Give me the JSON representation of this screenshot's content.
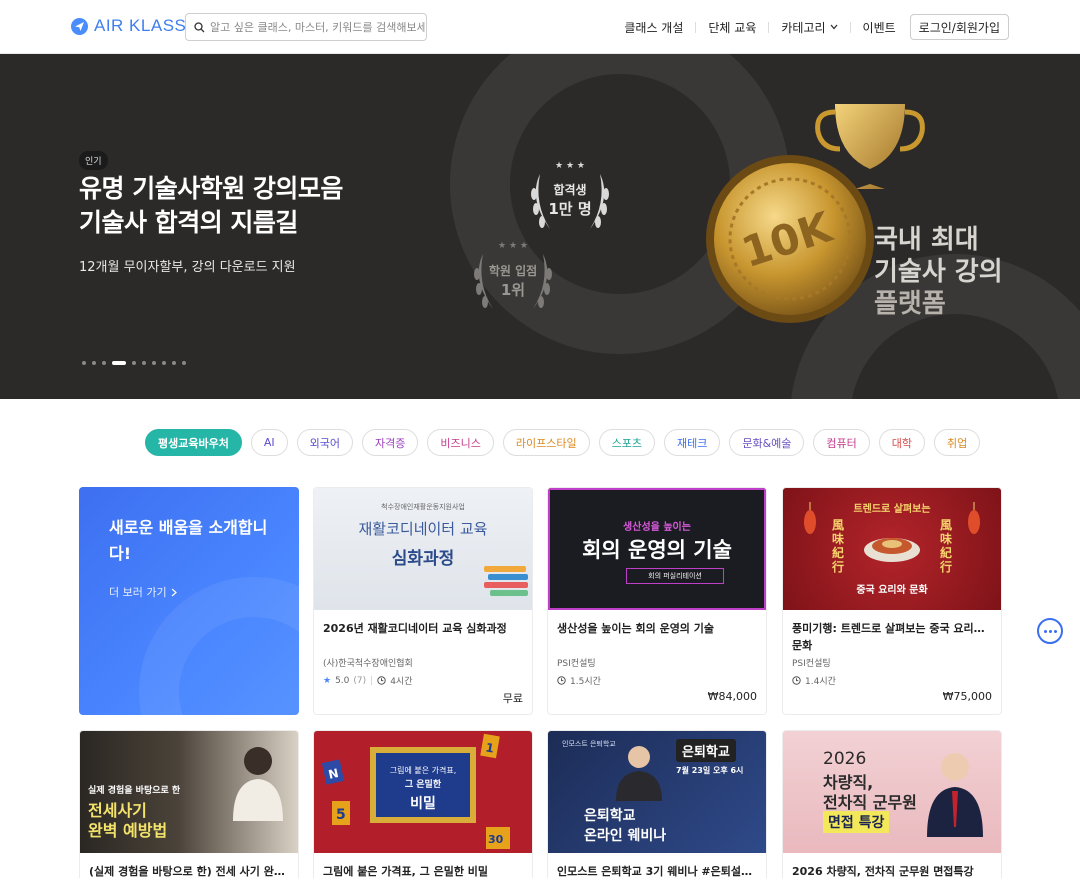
{
  "header": {
    "logo": "AIR KLASS",
    "search_placeholder": "알고 싶은 클래스, 마스터, 키워드를 검색해보세요",
    "nav": [
      "클래스 개설",
      "단체 교육",
      "카테고리",
      "이벤트"
    ],
    "login": "로그인/회원가입"
  },
  "hero": {
    "badge": "인기",
    "title_line1": "유명 기술사학원 강의모음",
    "title_line2": "기술사 합격의 지름길",
    "subtitle": "12개월 무이자할부, 강의 다운로드 지원",
    "laurel1_line1": "합격생",
    "laurel1_line2": "1만 명",
    "laurel2_line1": "학원 입점",
    "laurel2_line2": "1위",
    "medal_label": "10K",
    "headline_line1": "국내 최대",
    "headline_line2": "기술사 강의",
    "headline_line3": "플랫폼",
    "slide_count": 10,
    "active_slide": 4
  },
  "chips": [
    {
      "label": "평생교육바우처",
      "color": "#26b6a8",
      "active": true
    },
    {
      "label": "AI",
      "color": "#5a4fcf"
    },
    {
      "label": "외국어",
      "color": "#5a4fcf"
    },
    {
      "label": "자격증",
      "color": "#9b3fc2"
    },
    {
      "label": "비즈니스",
      "color": "#c43a8c"
    },
    {
      "label": "라이프스타일",
      "color": "#d98a1f"
    },
    {
      "label": "스포츠",
      "color": "#1fa596"
    },
    {
      "label": "재테크",
      "color": "#3a6ff0"
    },
    {
      "label": "문화&예술",
      "color": "#6b4fc2"
    },
    {
      "label": "컴퓨터",
      "color": "#c43a8c"
    },
    {
      "label": "대학",
      "color": "#d64a4a"
    },
    {
      "label": "취업",
      "color": "#d98a1f"
    }
  ],
  "promo": {
    "title": "새로운 배움을 소개합니다!",
    "link": "더 보러 가기"
  },
  "cards": [
    {
      "title": "2026년 재활코디네이터 교육 심화과정",
      "org": "(사)한국척수장애인협회",
      "rating": "5.0",
      "reviews": "(7)",
      "duration": "4시간",
      "price": "무료",
      "thumb_top": "척수장애인재활운동지원사업",
      "thumb_l1": "재활코디네이터 교육",
      "thumb_l2": "심화과정"
    },
    {
      "title": "생산성을 높이는 회의 운영의 기술",
      "org": "PSI컨설팅",
      "duration": "1.5시간",
      "price": "₩84,000",
      "thumb_l1": "생산성을 높이는",
      "thumb_l2": "회의 운영의 기술",
      "thumb_tag": "회의 퍼실리테이션"
    },
    {
      "title": "풍미기행: 트렌드로 살펴보는 중국 요리… 문화",
      "org": "PSI컨설팅",
      "duration": "1.4시간",
      "price": "₩75,000",
      "thumb_l1": "트렌드로 살펴보는",
      "thumb_l2": "중국 요리와 문화",
      "thumb_side": "風味紀行"
    }
  ],
  "cards_row2": [
    {
      "title": "(실제 경험을 바탕으로 한) 전세 사기 완…",
      "thumb_l1": "실제 경험을 바탕으로 한",
      "thumb_l2": "전세사기",
      "thumb_l3": "완벽 예방법"
    },
    {
      "title": "그림에 붙은 가격표, 그 은밀한 비밀",
      "thumb_l1": "그림에 붙은 가격표,",
      "thumb_l2": "그 은밀한",
      "thumb_l3": "비밀"
    },
    {
      "title": "인모스트 은퇴학교 3기 웨비나 #은퇴설…",
      "thumb_l1": "인모스트 은퇴학교",
      "thumb_l2": "은퇴학교",
      "thumb_l3": "온라인 웨비나",
      "thumb_date": "7월 23일 오후 6시"
    },
    {
      "title": "2026 차량직, 전차직 군무원 면접특강",
      "thumb_l1": "2026",
      "thumb_l2": "차량직,",
      "thumb_l3": "전차직 군무원",
      "thumb_l4": "면접 특강"
    }
  ]
}
